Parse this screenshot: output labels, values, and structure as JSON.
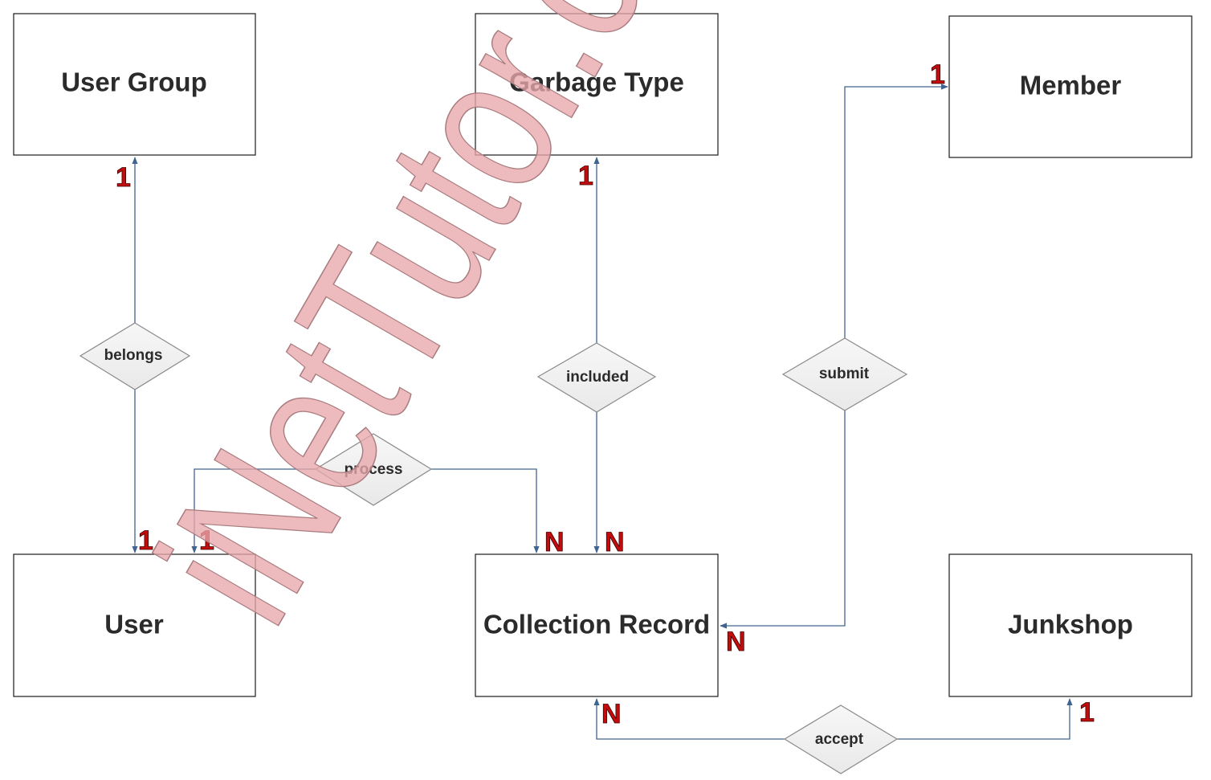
{
  "diagram": {
    "type": "entity-relationship",
    "entities": [
      {
        "id": "user_group",
        "label": "User Group"
      },
      {
        "id": "garbage_type",
        "label": "Garbage Type"
      },
      {
        "id": "member",
        "label": "Member"
      },
      {
        "id": "user",
        "label": "User"
      },
      {
        "id": "collection_record",
        "label": "Collection Record"
      },
      {
        "id": "junkshop",
        "label": "Junkshop"
      }
    ],
    "relationships": [
      {
        "id": "belongs",
        "label": "belongs",
        "from": "user",
        "to": "user_group",
        "from_card": "1",
        "to_card": "1"
      },
      {
        "id": "included",
        "label": "included",
        "from": "collection_record",
        "to": "garbage_type",
        "from_card": "N",
        "to_card": "1"
      },
      {
        "id": "submit",
        "label": "submit",
        "from": "collection_record",
        "to": "member",
        "from_card": "N",
        "to_card": "1"
      },
      {
        "id": "process",
        "label": "process",
        "from": "user",
        "to": "collection_record",
        "from_card": "1",
        "to_card": "N"
      },
      {
        "id": "accept",
        "label": "accept",
        "from": "collection_record",
        "to": "junkshop",
        "from_card": "N",
        "to_card": "1"
      }
    ],
    "cardinality_labels": {
      "user_group_belongs": "1",
      "user_belongs": "1",
      "user_process": "1",
      "garbage_type_included": "1",
      "collection_record_process": "N",
      "collection_record_included": "N",
      "collection_record_submit": "N",
      "collection_record_accept": "N",
      "member_submit": "1",
      "junkshop_accept": "1"
    },
    "colors": {
      "cardinality": "#c40c0c",
      "connector": "#41648f",
      "entity_border": "#1a1a1a",
      "watermark": "#e8a7ab"
    }
  },
  "watermark": {
    "text": "iNetTutor.com"
  }
}
